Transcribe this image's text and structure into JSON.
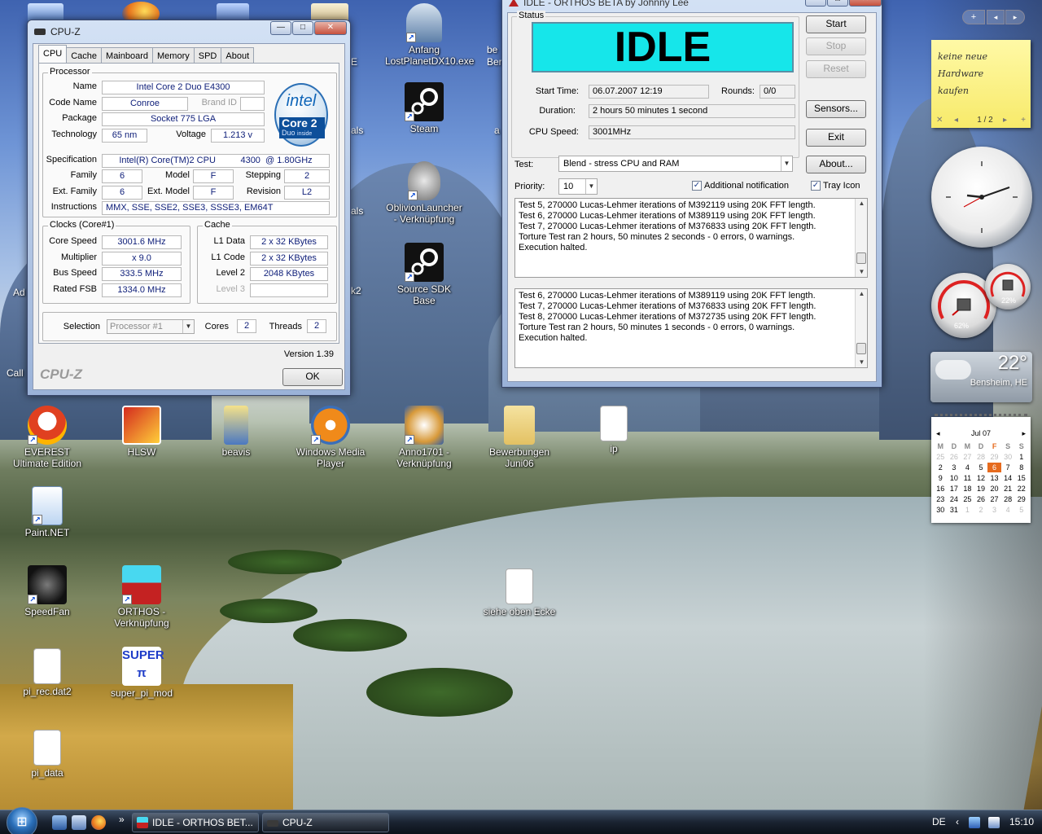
{
  "desktop": {
    "icons": [
      {
        "label": "Anfang LostPlanetDX10.exe"
      },
      {
        "label": "Steam"
      },
      {
        "label": "OblivionLauncher - Verknüpfung"
      },
      {
        "label": "Source SDK Base"
      },
      {
        "label": "EVEREST Ultimate Edition"
      },
      {
        "label": "HLSW"
      },
      {
        "label": "beavis"
      },
      {
        "label": "Windows Media Player"
      },
      {
        "label": "Anno1701 - Verknüpfung"
      },
      {
        "label": "Bewerbungen Juni06"
      },
      {
        "label": "ip"
      },
      {
        "label": "Paint.NET"
      },
      {
        "label": "SpeedFan"
      },
      {
        "label": "ORTHOS - Verknüpfung"
      },
      {
        "label": "siehe oben Ecke"
      },
      {
        "label": "pi_rec.dat2"
      },
      {
        "label": "super_pi_mod"
      },
      {
        "label": "pi_data"
      }
    ],
    "partial_labels": {
      "ad": "Ad",
      "call": "Call",
      "e": "E",
      "be": "be",
      "ber": "Ber",
      "als1": "als",
      "als2": "als",
      "a": "a",
      "k2": "k2"
    }
  },
  "cpuz": {
    "title": "CPU-Z",
    "tabs": [
      "CPU",
      "Cache",
      "Mainboard",
      "Memory",
      "SPD",
      "About"
    ],
    "processor": {
      "group_label": "Processor",
      "name_label": "Name",
      "name": "Intel Core 2 Duo E4300",
      "codename_label": "Code Name",
      "codename": "Conroe",
      "brandid_label": "Brand ID",
      "brandid": "",
      "package_label": "Package",
      "package": "Socket 775 LGA",
      "technology_label": "Technology",
      "technology": "65 nm",
      "voltage_label": "Voltage",
      "voltage": "1.213 v",
      "spec_label": "Specification",
      "spec": "Intel(R) Core(TM)2 CPU          4300  @ 1.80GHz",
      "family_label": "Family",
      "family": "6",
      "model_label": "Model",
      "model": "F",
      "stepping_label": "Stepping",
      "stepping": "2",
      "extfamily_label": "Ext. Family",
      "extfamily": "6",
      "extmodel_label": "Ext. Model",
      "extmodel": "F",
      "revision_label": "Revision",
      "revision": "L2",
      "instructions_label": "Instructions",
      "instructions": "MMX, SSE, SSE2, SSE3, SSSE3, EM64T",
      "logo": {
        "brand": "intel",
        "line1": "Core 2",
        "line2": "Duo",
        "inside": "inside"
      }
    },
    "clocks": {
      "group_label": "Clocks (Core#1)",
      "core_speed_label": "Core Speed",
      "core_speed": "3001.6 MHz",
      "multiplier_label": "Multiplier",
      "multiplier": "x 9.0",
      "bus_speed_label": "Bus Speed",
      "bus_speed": "333.5 MHz",
      "fsb_label": "Rated FSB",
      "fsb": "1334.0 MHz"
    },
    "cache": {
      "group_label": "Cache",
      "l1data_label": "L1 Data",
      "l1data": "2 x 32 KBytes",
      "l1code_label": "L1 Code",
      "l1code": "2 x 32 KBytes",
      "level2_label": "Level 2",
      "level2": "2048 KBytes",
      "level3_label": "Level 3",
      "level3": ""
    },
    "selection": {
      "label": "Selection",
      "value": "Processor #1",
      "cores_label": "Cores",
      "cores": "2",
      "threads_label": "Threads",
      "threads": "2"
    },
    "version": "Version 1.39",
    "footer_brand": "CPU-Z",
    "ok_label": "OK"
  },
  "orthos": {
    "title": "IDLE - ORTHOS BETA by Johnny Lee",
    "status_group": "Status",
    "status": "IDLE",
    "start_time_label": "Start Time:",
    "start_time": "06.07.2007 12:19",
    "rounds_label": "Rounds:",
    "rounds": "0/0",
    "duration_label": "Duration:",
    "duration": "2 hours 50 minutes 1 second",
    "cpu_speed_label": "CPU Speed:",
    "cpu_speed": "3001MHz",
    "test_label": "Test:",
    "test": "Blend - stress CPU and RAM",
    "priority_label": "Priority:",
    "priority": "10",
    "additional_notification": "Additional notification",
    "tray_icon": "Tray Icon",
    "buttons": {
      "start": "Start",
      "stop": "Stop",
      "reset": "Reset",
      "sensors": "Sensors...",
      "exit": "Exit",
      "about": "About..."
    },
    "log1": [
      "Test 5, 270000 Lucas-Lehmer iterations of M392119 using 20K FFT length.",
      "Test 6, 270000 Lucas-Lehmer iterations of M389119 using 20K FFT length.",
      "Test 7, 270000 Lucas-Lehmer iterations of M376833 using 20K FFT length.",
      "Torture Test ran 2 hours, 50 minutes 2 seconds - 0 errors, 0 warnings.",
      "Execution halted."
    ],
    "log2": [
      "Test 6, 270000 Lucas-Lehmer iterations of M389119 using 20K FFT length.",
      "Test 7, 270000 Lucas-Lehmer iterations of M376833 using 20K FFT length.",
      "Test 8, 270000 Lucas-Lehmer iterations of M372735 using 20K FFT length.",
      "Torture Test ran 2 hours, 50 minutes 1 seconds - 0 errors, 0 warnings.",
      "Execution halted."
    ]
  },
  "sidebar": {
    "note_lines": [
      "keine neue",
      "Hardware",
      "kaufen"
    ],
    "note_pager": "1 / 2",
    "gauge_cpu": "62%",
    "gauge_ram": "22%",
    "weather_temp": "22°",
    "weather_city": "Bensheim, HE",
    "calendar": {
      "month": "Jul 07",
      "dow": [
        "M",
        "D",
        "M",
        "D",
        "F",
        "S",
        "S"
      ],
      "days": [
        "25",
        "26",
        "27",
        "28",
        "29",
        "30",
        "1",
        "2",
        "3",
        "4",
        "5",
        "6",
        "7",
        "8",
        "9",
        "10",
        "11",
        "12",
        "13",
        "14",
        "15",
        "16",
        "17",
        "18",
        "19",
        "20",
        "21",
        "22",
        "23",
        "24",
        "25",
        "26",
        "27",
        "28",
        "29",
        "30",
        "31",
        "1",
        "2",
        "3",
        "4",
        "5"
      ],
      "today": "6"
    }
  },
  "taskbar": {
    "tasks": [
      "IDLE - ORTHOS BET...",
      "CPU-Z"
    ],
    "lang": "DE",
    "time": "15:10",
    "chevron": "»",
    "tray_chevron": "‹"
  }
}
